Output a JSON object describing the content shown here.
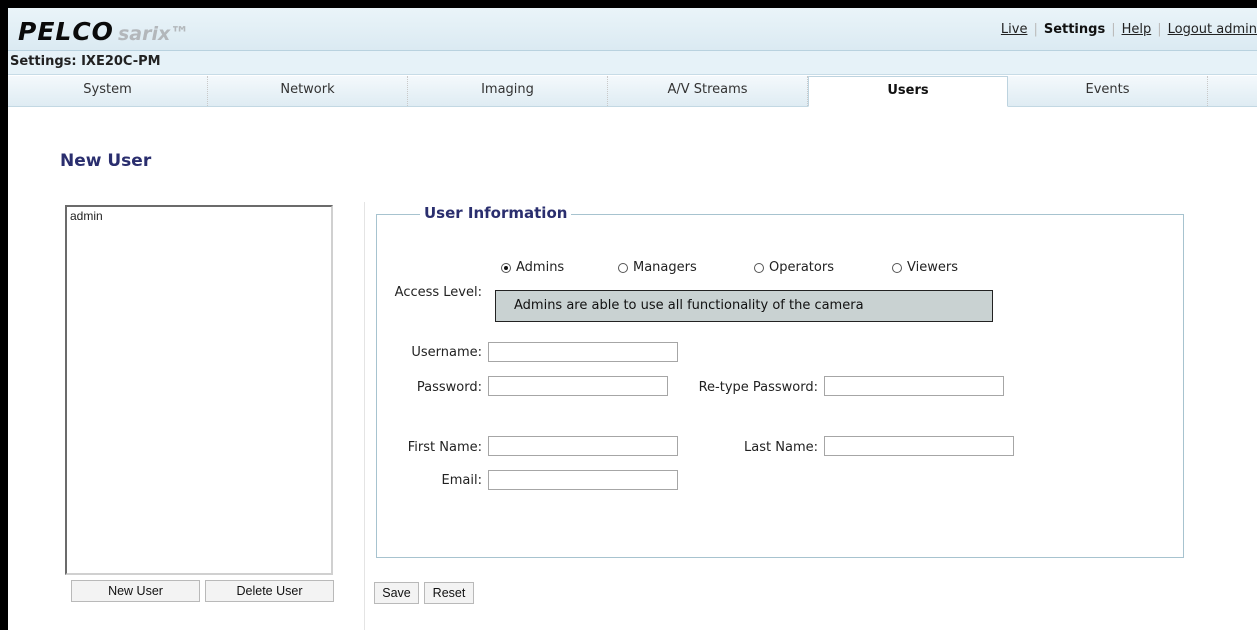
{
  "header": {
    "logo_brand": "PELCO",
    "logo_product": "sarix™",
    "links": {
      "live": "Live",
      "settings": "Settings",
      "help": "Help",
      "logout": "Logout admin"
    },
    "settings_title": "Settings: IXE20C-PM"
  },
  "tabs": [
    {
      "label": "System",
      "active": false
    },
    {
      "label": "Network",
      "active": false
    },
    {
      "label": "Imaging",
      "active": false
    },
    {
      "label": "A/V Streams",
      "active": false
    },
    {
      "label": "Users",
      "active": true
    },
    {
      "label": "Events",
      "active": false
    }
  ],
  "page": {
    "title": "New User",
    "user_list": [
      "admin"
    ],
    "new_user_button": "New User",
    "delete_user_button": "Delete User"
  },
  "form": {
    "legend": "User Information",
    "access_level_label": "Access Level:",
    "access_levels": [
      "Admins",
      "Managers",
      "Operators",
      "Viewers"
    ],
    "selected_access_level": "Admins",
    "access_description": "Admins are able to use all functionality of the camera",
    "username_label": "Username:",
    "password_label": "Password:",
    "retype_password_label": "Re-type Password:",
    "first_name_label": "First Name:",
    "last_name_label": "Last Name:",
    "email_label": "Email:",
    "username": "",
    "password": "",
    "retype_password": "",
    "first_name": "",
    "last_name": "",
    "email": "",
    "save_button": "Save",
    "reset_button": "Reset"
  },
  "colors": {
    "heading": "#2a2e6e",
    "header_bg": "#dbeaf2",
    "description_bg": "#c9d2d2"
  }
}
